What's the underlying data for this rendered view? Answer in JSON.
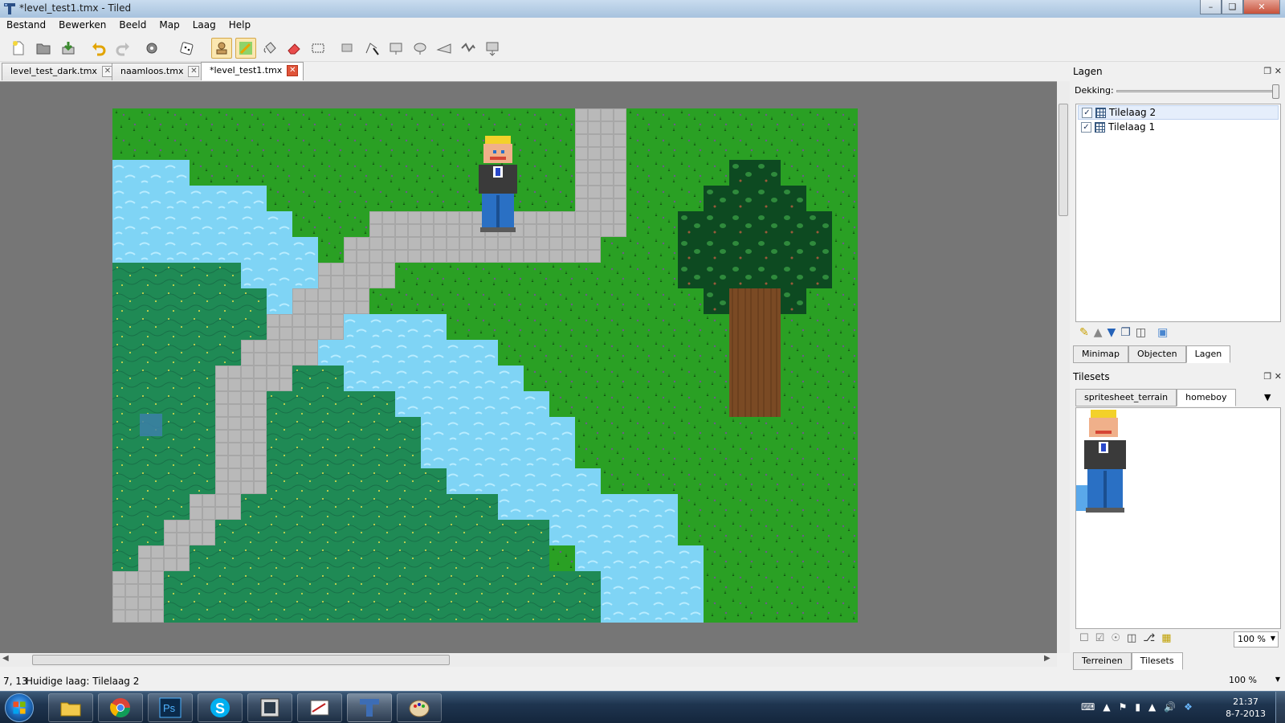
{
  "window": {
    "title": "*level_test1.tmx - Tiled"
  },
  "menu": [
    "Bestand",
    "Bewerken",
    "Beeld",
    "Map",
    "Laag",
    "Help"
  ],
  "toolbar": [
    "new-map-icon",
    "open-icon",
    "save-icon",
    "undo-icon",
    "redo-icon",
    "stamp-random-icon",
    "dice-icon",
    "stamp-brush-icon",
    "terrain-brush-icon",
    "bucket-fill-icon",
    "eraser-icon",
    "rect-select-icon",
    "select-objects-icon",
    "edit-polygons-icon",
    "insert-rectangle-icon",
    "insert-ellipse-icon",
    "insert-polygon-icon",
    "insert-polyline-icon",
    "insert-tile-icon"
  ],
  "tabs": {
    "items": [
      {
        "label": "level_test_dark.tmx"
      },
      {
        "label": "naamloos.tmx"
      },
      {
        "label": "*level_test1.tmx",
        "active": true
      }
    ]
  },
  "layers_panel": {
    "title": "Lagen",
    "opacity_label": "Dekking:",
    "opacity": 1.0,
    "layers": [
      {
        "name": "Tilelaag 2",
        "visible": true,
        "selected": true
      },
      {
        "name": "Tilelaag 1",
        "visible": true,
        "selected": false
      }
    ],
    "tabs": [
      "Minimap",
      "Objecten",
      "Lagen"
    ],
    "active_tab": "Lagen"
  },
  "tilesets_panel": {
    "title": "Tilesets",
    "tabs": [
      "spritesheet_terrain",
      "homeboy"
    ],
    "active_tab": "homeboy",
    "zoom": "100 %",
    "bottom_tabs": [
      "Terreinen",
      "Tilesets"
    ],
    "active_bottom_tab": "Tilesets"
  },
  "status": {
    "coords": "7, 13",
    "current_layer": "Huidige laag: Tilelaag 2",
    "zoom": "100 %"
  },
  "taskbar": {
    "apps": [
      "explorer",
      "chrome",
      "photoshop",
      "skype",
      "window-app",
      "editor-app",
      "tiled",
      "paint-app"
    ],
    "time": "21:37",
    "date": "8-7-2013"
  },
  "colors": {
    "grass": "#2aa024",
    "dark_grass": "#1f8a55",
    "water": "#7fd4f5",
    "path": "#b9b9b9",
    "tree_leaves": "#0d4a21",
    "tree_trunk": "#7a4a24",
    "viewport_bg": "#767676"
  }
}
